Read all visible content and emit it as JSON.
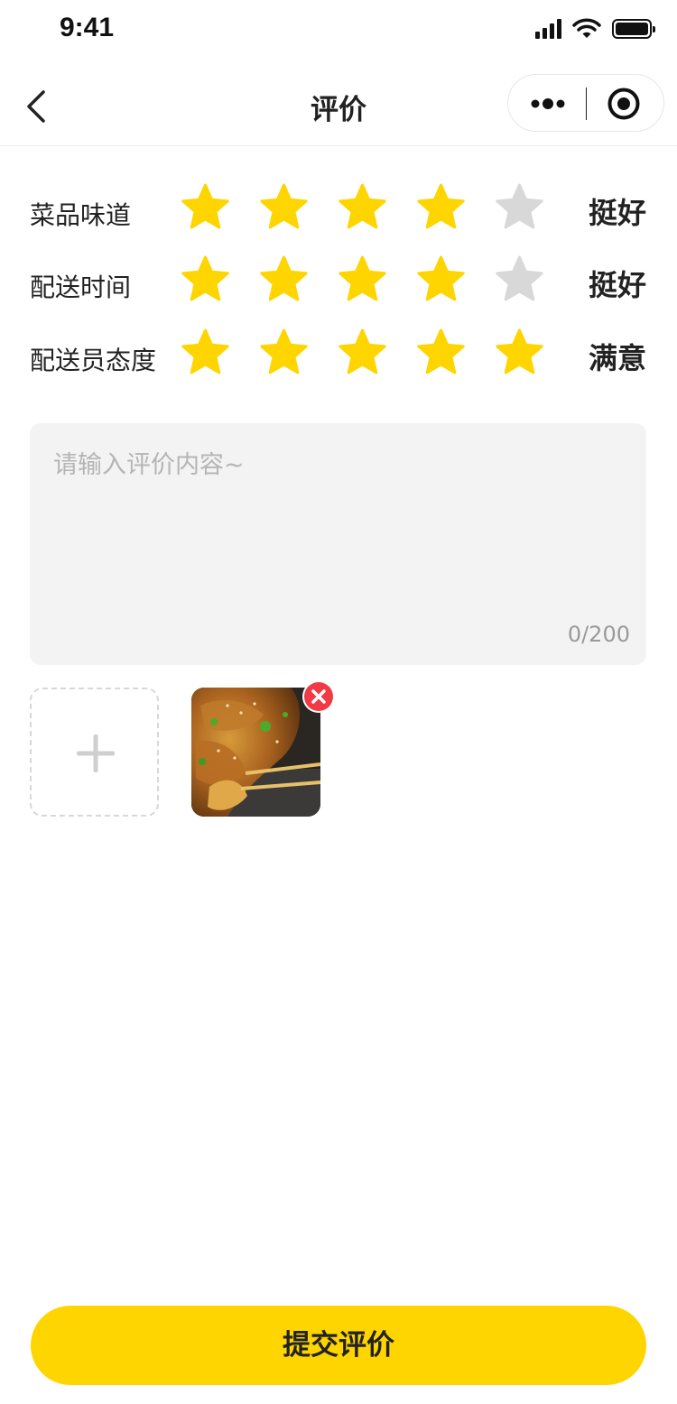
{
  "status_bar": {
    "time": "9:41"
  },
  "nav": {
    "title": "评价"
  },
  "ratings": [
    {
      "label": "菜品味道",
      "score": 4,
      "max": 5,
      "text": "挺好"
    },
    {
      "label": "配送时间",
      "score": 4,
      "max": 5,
      "text": "挺好"
    },
    {
      "label": "配送员态度",
      "score": 5,
      "max": 5,
      "text": "满意"
    }
  ],
  "comment": {
    "placeholder": "请输入评价内容~",
    "value": "",
    "count": "0/200"
  },
  "photos": [
    {
      "icon": "food-photo"
    }
  ],
  "submit": {
    "label": "提交评价"
  },
  "colors": {
    "accent": "#FFD500",
    "star_on": "#FFD500",
    "star_off": "#D8D8D8",
    "remove": "#F03A46"
  },
  "icons": {
    "back": "chevron-left-icon",
    "more": "more-dots-icon",
    "close": "target-close-icon",
    "add": "plus-icon",
    "remove": "remove-circle-icon"
  }
}
